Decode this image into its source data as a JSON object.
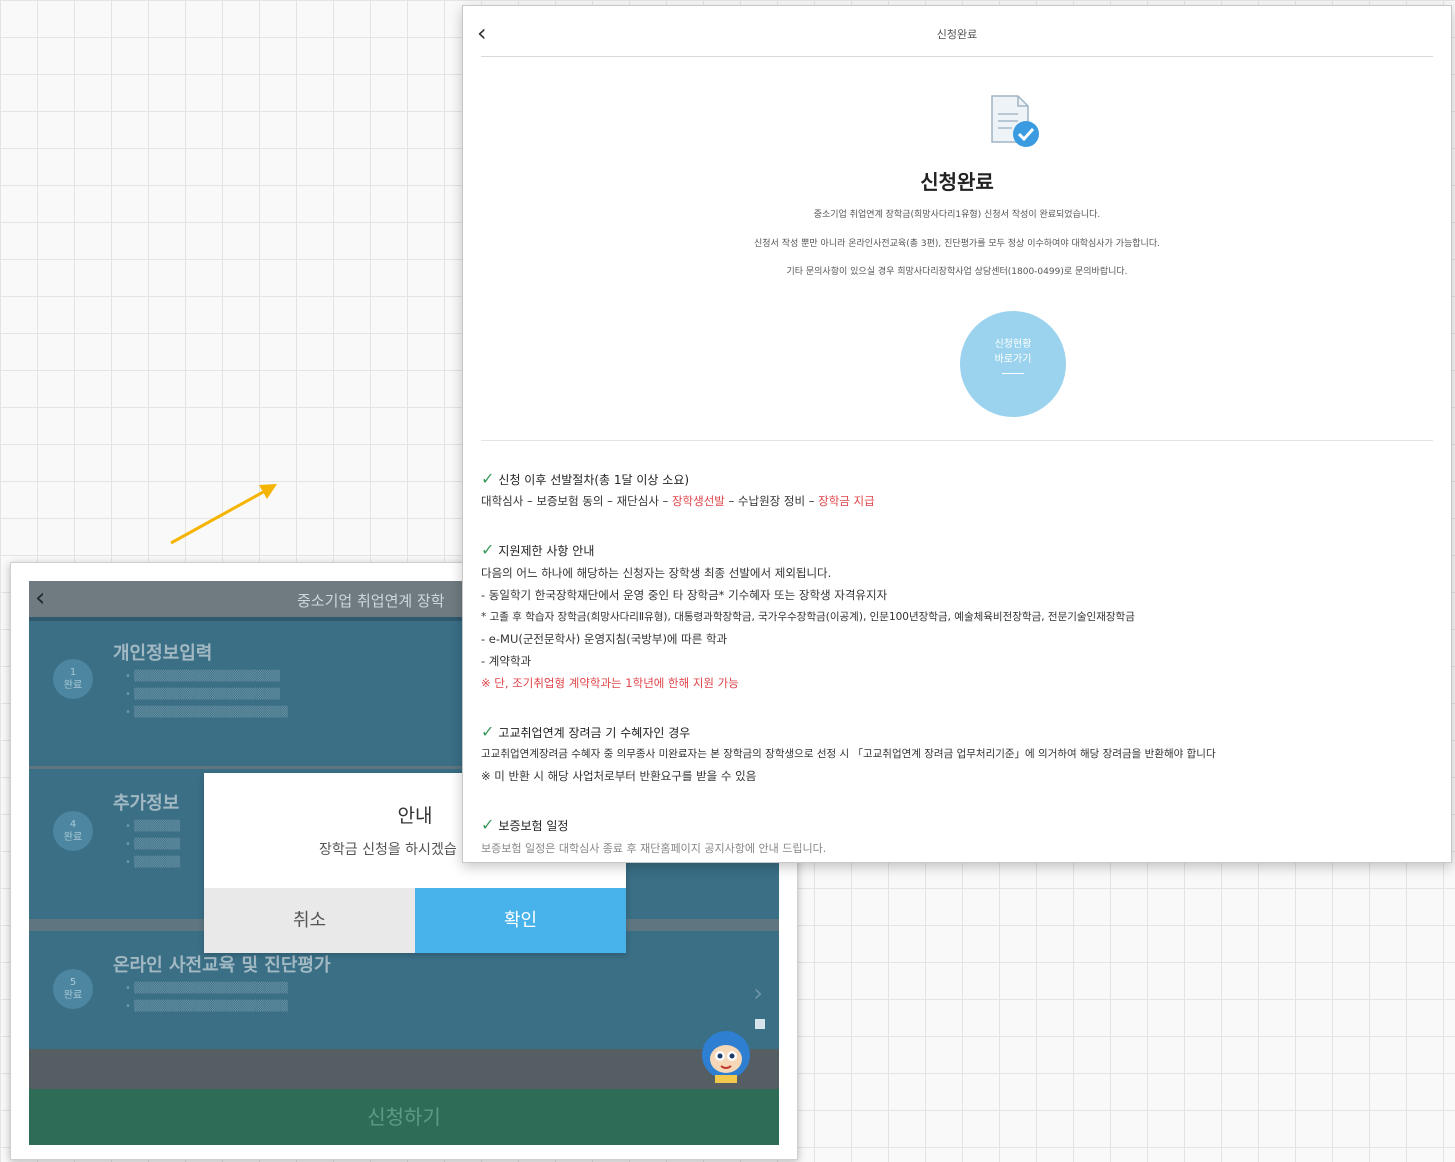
{
  "left_screen": {
    "back_icon": "chevron-left-icon",
    "header_title": "중소기업 취업연계 장학",
    "steps": [
      {
        "badge": "1",
        "badge_sub": "완료",
        "title": "개인정보입력"
      },
      {
        "badge": "4",
        "badge_sub": "완료",
        "title": "추가정보"
      },
      {
        "badge": "5",
        "badge_sub": "완료",
        "title": "온라인 사전교육 및 진단평가"
      }
    ],
    "dialog": {
      "title": "안내",
      "message": "장학금 신청을 하시겠습",
      "cancel_label": "취소",
      "ok_label": "확인"
    },
    "apply_label": "신청하기"
  },
  "right_window": {
    "back_icon": "chevron-left-icon",
    "header_title": "신청완료",
    "complete_title": "신청완료",
    "info_lines": [
      "중소기업 취업연계 장학금(희망사다리1유형) 신청서 작성이 완료되었습니다.",
      "신청서 작성 뿐만 아니라 온라인사전교육(총 3편), 진단평가를 모두 정상 이수하여야 대학심사가 가능합니다.",
      "기타 문의사항이 있으실 경우 희망사다리장학사업 상담센터(1800-0499)로 문의바랍니다."
    ],
    "status_button": {
      "line1": "신청현황",
      "line2": "바로가기"
    },
    "sections": {
      "s1": {
        "title": "신청 이후 선발절차(총 1달 이상 소요)",
        "process_normal_1": "대학심사 – 보증보험 동의 – 재단심사 – ",
        "process_red_1": "장학생선발",
        "process_normal_2": " – 수납원장 정비 – ",
        "process_red_2": "장학금 지급"
      },
      "s2": {
        "title": "지원제한 사항 안내",
        "line1": "다음의 어느 하나에 해당하는 신청자는 장학생 최종 선발에서 제외됩니다.",
        "line2": "- 동일학기 한국장학재단에서 운영 중인 타 장학금* 기수혜자 또는 장학생 자격유지자",
        "line3": "* 고졸 후 학습자 장학금(희망사다리Ⅱ유형), 대통령과학장학금, 국가우수장학금(이공계), 인문100년장학금, 예술체육비전장학금, 전문기술인재장학금",
        "line4": "- e-MU(군전문학사) 운영지침(국방부)에 따른 학과",
        "line5": "- 계약학과",
        "line6": "※ 단, 조기취업형 계약학과는 1학년에 한해 지원 가능"
      },
      "s3": {
        "title": "고교취업연계 장려금 기 수혜자인 경우",
        "line1": "고교취업연계장려금 수혜자 중 의무종사 미완료자는 본 장학금의 장학생으로 선정 시 「고교취업연계 장려금 업무처리기준」에 의거하여 해당 장려금을 반환해야 합니다",
        "line2": "※ 미 반환 시 해당 사업처로부터 반환요구를 받을 수 있음"
      },
      "s4": {
        "title": "보증보험 일정",
        "cut_line": "보증보험 일정은 대학심사 종료 후 재단홈페이지 공지사항에 안내 드립니다."
      }
    }
  },
  "colors": {
    "accent_blue": "#47b3ea",
    "status_circle": "#9bd3ee",
    "check_green": "#3a9a5a",
    "warning_red": "#e0444a",
    "arrow_yellow": "#f5b400"
  }
}
